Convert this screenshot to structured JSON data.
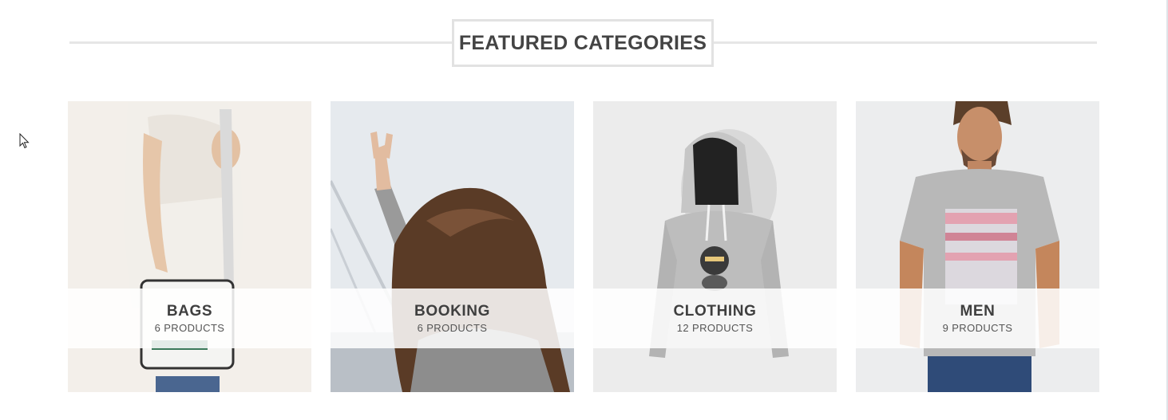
{
  "section": {
    "title": "FEATURED CATEGORIES"
  },
  "categories": [
    {
      "name": "BAGS",
      "count": "6 PRODUCTS",
      "icon": "bag-photo"
    },
    {
      "name": "BOOKING",
      "count": "6 PRODUCTS",
      "icon": "travel-photo"
    },
    {
      "name": "CLOTHING",
      "count": "12 PRODUCTS",
      "icon": "hoodie-photo"
    },
    {
      "name": "MEN",
      "count": "9 PRODUCTS",
      "icon": "man-tshirt-photo"
    }
  ],
  "colors": {
    "title_text": "#444444",
    "title_border": "#e2e2e2",
    "caption_bg": "#ffffff",
    "caption_text": "#3f3f3f"
  }
}
